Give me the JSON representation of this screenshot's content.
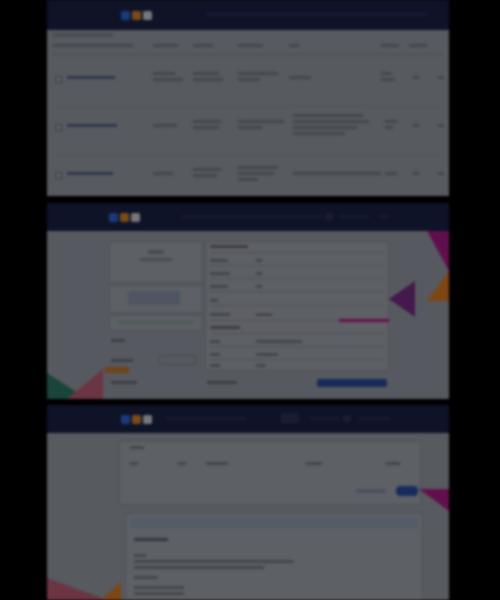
{
  "panels": [
    {
      "topbar": {
        "logo_colors": [
          "#2b6be0",
          "#e0892b",
          "#d8d8e0"
        ]
      },
      "table": {
        "rows": 3
      }
    },
    {
      "topbar": {
        "logo_colors": [
          "#2b6be0",
          "#e0892b",
          "#d8d8e0"
        ]
      },
      "colors": {
        "accent_blue": "#2c4fa7",
        "accent_orange": "#c97a2a",
        "decor_magenta": "#c2188a",
        "decor_orange": "#e67e22",
        "decor_purple": "#7b2d8e"
      }
    },
    {
      "topbar": {
        "logo_colors": [
          "#2b6be0",
          "#e0892b",
          "#d8d8e0"
        ]
      },
      "colors": {
        "accent_blue": "#2c4fa7",
        "decor_magenta": "#b01c8a"
      }
    }
  ],
  "icons": [
    "logo-mark",
    "checkbox-icon",
    "decor-triangle"
  ]
}
